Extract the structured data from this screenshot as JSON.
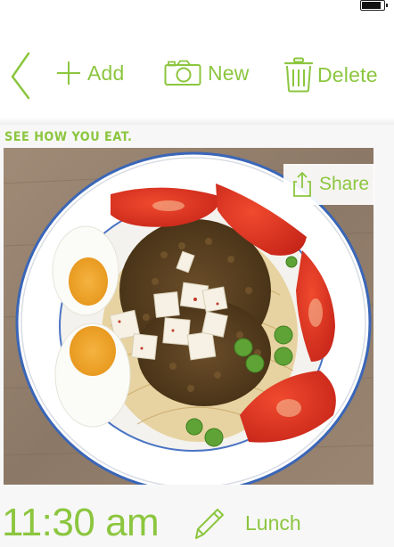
{
  "status_bar": {
    "battery_level": 0.8
  },
  "toolbar": {
    "back_icon": "chevron-left-icon",
    "add_label": "Add",
    "new_label": "New",
    "delete_label": "Delete"
  },
  "entry": {
    "tagline": "SEE HOW YOU EAT.",
    "share_label": "Share",
    "time": "11:30 am",
    "meal": "Lunch"
  },
  "colors": {
    "accent": "#8cc63f"
  }
}
